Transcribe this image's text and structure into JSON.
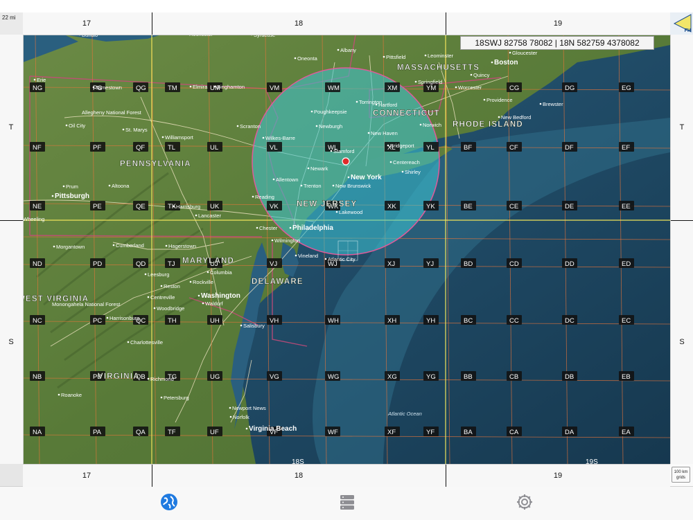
{
  "scale_label": "22 mi",
  "coordinate_readout": "18SWJ 82758 78082 | 18N 582759 4378082",
  "fh_button_label": "FH",
  "grid_size_label": [
    "100 km",
    "grids"
  ],
  "zones": [
    "17",
    "18",
    "19"
  ],
  "latitude_bands": [
    "T",
    "S"
  ],
  "bottom_zone_overlay": [
    "18S",
    "19S"
  ],
  "map_colors": {
    "land": "#5b7a3c",
    "ocean": "#1e4a66",
    "mgrs_grid": "#e8753a",
    "zone_line": "#f0e45a",
    "range_circle": "#3ec7d6"
  },
  "grid_squares": [
    "NG",
    "PG",
    "QG",
    "TM",
    "UM",
    "VM",
    "WM",
    "XM",
    "YM",
    "CG",
    "DG",
    "EG",
    "NF",
    "PF",
    "QF",
    "TL",
    "UL",
    "VL",
    "WL",
    "XL",
    "YL",
    "BF",
    "CF",
    "DF",
    "EF",
    "NE",
    "PE",
    "QE",
    "TK",
    "UK",
    "VK",
    "WK",
    "XK",
    "YK",
    "BE",
    "CE",
    "DE",
    "EE",
    "ND",
    "PD",
    "QD",
    "TJ",
    "UJ",
    "VJ",
    "WJ",
    "XJ",
    "YJ",
    "BD",
    "CD",
    "DD",
    "ED",
    "NC",
    "PC",
    "QC",
    "TH",
    "UH",
    "VH",
    "WH",
    "XH",
    "YH",
    "BC",
    "CC",
    "DC",
    "EC",
    "NB",
    "PB",
    "QB",
    "TG",
    "UG",
    "VG",
    "WG",
    "XG",
    "YG",
    "BB",
    "CB",
    "DB",
    "EB",
    "NA",
    "PA",
    "QA",
    "TF",
    "UF",
    "VF",
    "WF",
    "XF",
    "YF",
    "BA",
    "CA",
    "DA",
    "EA"
  ],
  "state_labels": [
    "PENNSYLVANIA",
    "MARYLAND",
    "DELAWARE",
    "NEW JERSEY",
    "CONNECTICUT",
    "RHODE ISLAND",
    "MASSACHUSETTS",
    "VIRGINIA",
    "WEST VIRGINIA"
  ],
  "city_labels": [
    "Buffalo",
    "Rochester",
    "Syracuse",
    "Albany",
    "Oneonta",
    "Pittsfield",
    "Leominster",
    "Boston",
    "Gloucester",
    "Quincy",
    "Worcester",
    "Springfield",
    "Providence",
    "Brewster",
    "New Bedford",
    "Erie",
    "Jamestown",
    "Elmira",
    "Binghamton",
    "Scranton",
    "Poughkeepsie",
    "Torrington",
    "Hartford",
    "Norwich",
    "New Haven",
    "Bridgeport",
    "Stamford",
    "Newburgh",
    "Wilkes-Barre",
    "Oil City",
    "St. Marys",
    "Williamsport",
    "Allegheny National Forest",
    "Allentown",
    "Newark",
    "New York",
    "Centereach",
    "Shirley",
    "New Brunswick",
    "Trenton",
    "Reading",
    "Prum",
    "Altoona",
    "Pittsburgh",
    "Wheeling",
    "Harrisburg",
    "Lancaster",
    "Lakewood",
    "Chester",
    "Philadelphia",
    "Wilmington",
    "Vineland",
    "Atlantic City",
    "Morgantown",
    "Cumberland",
    "Hagerstown",
    "Leesburg",
    "Columbia",
    "Reston",
    "Rockville",
    "Centreville",
    "Woodbridge",
    "Washington",
    "Waldorf",
    "Salisbury",
    "Harrisonburg",
    "Charlottesville",
    "Richmond",
    "Petersburg",
    "Roanoke",
    "Newport News",
    "Norfolk",
    "Virginia Beach",
    "Monongahela National Forest",
    "Atlantic Ocean"
  ],
  "tabs": [
    {
      "name": "map-tab",
      "icon": "globe-icon",
      "active": true
    },
    {
      "name": "layers-tab",
      "icon": "database-icon",
      "active": false
    },
    {
      "name": "settings-tab",
      "icon": "gear-icon",
      "active": false
    }
  ]
}
